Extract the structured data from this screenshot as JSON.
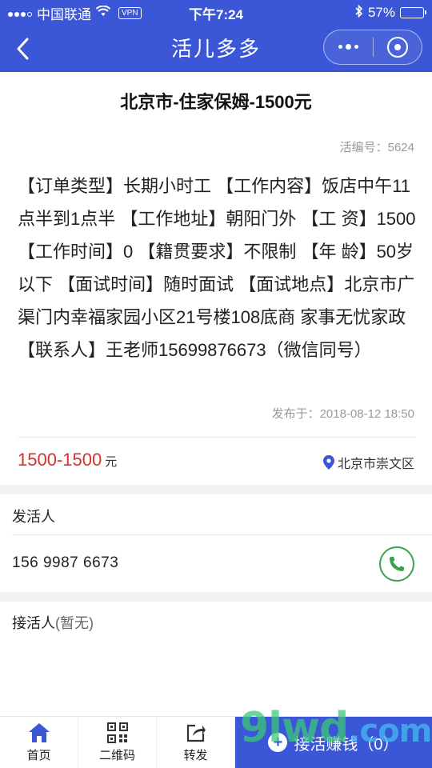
{
  "status_bar": {
    "carrier": "中国联通",
    "vpn": "VPN",
    "time": "下午7:24",
    "battery_text": "57%",
    "battery_level": 0.57
  },
  "nav": {
    "title": "活儿多多"
  },
  "post": {
    "title": "北京市-住家保姆-1500元",
    "job_no": "活编号：5624",
    "description": "【订单类型】长期小时工 【工作内容】饭店中午11点半到1点半 【工作地址】朝阳门外 【工 资】1500 【工作时间】0 【籍贯要求】不限制 【年 龄】50岁以下 【面试时间】随时面试 【面试地点】北京市广渠门内幸福家园小区21号楼108底商 家事无忧家政 【联系人】王老师15699876673（微信同号）",
    "published": "发布于：2018-08-12 18:50",
    "price": "1500-1500",
    "price_unit": "元",
    "location": "北京市崇文区"
  },
  "poster": {
    "label": "发活人",
    "phone": "156 9987 6673"
  },
  "receiver": {
    "label": "接活人",
    "none_text": "(暂无)"
  },
  "tabs": [
    {
      "label": "首页"
    },
    {
      "label": "二维码"
    },
    {
      "label": "转发"
    }
  ],
  "accept_button": "接活赚钱（0）",
  "colors": {
    "primary": "#3b56d6",
    "price": "#d0342c",
    "call": "#3aa34a"
  },
  "watermark": {
    "main": "9lwd",
    "suffix": ".com"
  }
}
